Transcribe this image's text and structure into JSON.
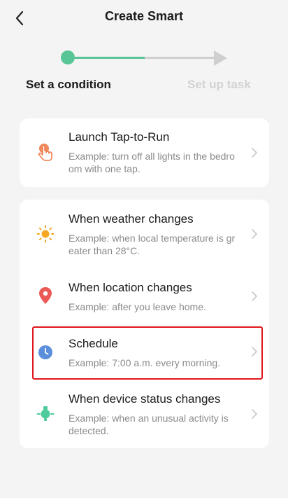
{
  "header": {
    "title": "Create Smart",
    "back_icon": "chevron-left-icon"
  },
  "stepper": {
    "steps": [
      {
        "label": "Set a condition",
        "state": "active"
      },
      {
        "label": "Set up task",
        "state": "pending"
      }
    ],
    "accent_color": "#58c596",
    "inactive_color": "#cfcfcf"
  },
  "cards": [
    {
      "items": [
        {
          "title": "Launch Tap-to-Run",
          "description": "Example: turn off all lights in the bedroom with one tap.",
          "icon": "tap-hand-icon",
          "icon_color": "#f07c4a"
        }
      ]
    },
    {
      "items": [
        {
          "title": "When weather changes",
          "description": "Example: when local temperature is greater than 28°C.",
          "icon": "sun-icon",
          "icon_color": "#f5a623"
        },
        {
          "title": "When location changes",
          "description": "Example: after you leave home.",
          "icon": "location-pin-icon",
          "icon_color": "#eb5a56"
        },
        {
          "title": "Schedule",
          "description": "Example: 7:00 a.m. every morning.",
          "icon": "clock-icon",
          "icon_color": "#5b8fdb",
          "highlighted": true
        },
        {
          "title": "When device status changes",
          "description": "Example: when an unusual activity is detected.",
          "icon": "device-icon",
          "icon_color": "#4ecb9c"
        }
      ]
    }
  ],
  "highlight_color": "#e0161c"
}
